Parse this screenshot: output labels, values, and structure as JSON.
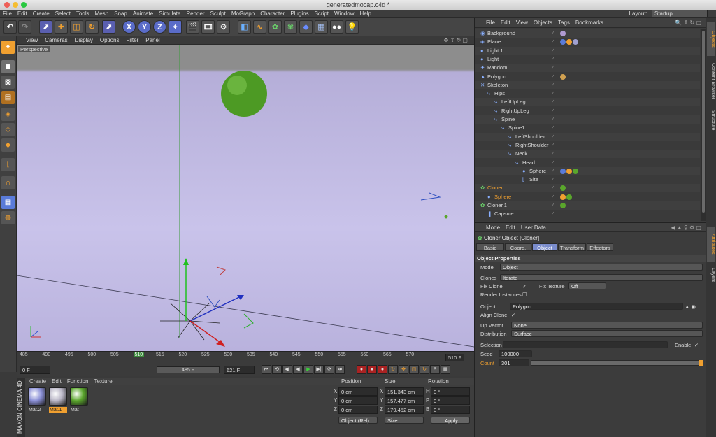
{
  "window": {
    "title": "generatedmocap.c4d *"
  },
  "menu": [
    "File",
    "Edit",
    "Create",
    "Select",
    "Tools",
    "Mesh",
    "Snap",
    "Animate",
    "Simulate",
    "Render",
    "Sculpt",
    "MoGraph",
    "Character",
    "Plugins",
    "Script",
    "Window",
    "Help"
  ],
  "layout": {
    "label": "Layout:",
    "value": "Startup"
  },
  "toolbar": {
    "x": "X",
    "y": "Y",
    "z": "Z"
  },
  "viewport": {
    "menu": [
      "View",
      "Cameras",
      "Display",
      "Options",
      "Filter",
      "Panel"
    ],
    "label": "Perspective"
  },
  "timeline": {
    "ticks": [
      "485",
      "490",
      "495",
      "500",
      "505",
      "510",
      "515",
      "520",
      "525",
      "530",
      "535",
      "540",
      "545",
      "550",
      "555",
      "560",
      "565",
      "570"
    ],
    "current": "510",
    "current_frame": "510 F"
  },
  "transport": {
    "start": "0 F",
    "mid": "485 F",
    "end": "621 F"
  },
  "materials": {
    "menu": [
      "Create",
      "Edit",
      "Function",
      "Texture"
    ],
    "items": [
      {
        "name": "Mat.2",
        "color": "#8a8fd6"
      },
      {
        "name": "Mat.1",
        "color": "#b9b6c6"
      },
      {
        "name": "Mat",
        "color": "#5aa62c"
      }
    ],
    "logo": "MAXON CINEMA 4D"
  },
  "coords": {
    "headers": [
      "Position",
      "Size",
      "Rotation"
    ],
    "rows": [
      {
        "axis": "X",
        "pos": "0 cm",
        "size": "151.343 cm",
        "rlabel": "H",
        "rot": "0 °"
      },
      {
        "axis": "Y",
        "pos": "0 cm",
        "size": "157.477 cm",
        "rlabel": "P",
        "rot": "0 °"
      },
      {
        "axis": "Z",
        "pos": "0 cm",
        "size": "179.452 cm",
        "rlabel": "B",
        "rot": "0 °"
      }
    ],
    "mode": "Object (Rel)",
    "size_mode": "Size",
    "apply": "Apply"
  },
  "objects": {
    "menu": [
      "File",
      "Edit",
      "View",
      "Objects",
      "Tags",
      "Bookmarks"
    ],
    "items": [
      {
        "name": "Background",
        "indent": 0,
        "tags": [
          "#b09ad0"
        ]
      },
      {
        "name": "Plane",
        "indent": 0,
        "tags": [
          "#5a7bd8",
          "#f0a030",
          "#a0a0d0"
        ]
      },
      {
        "name": "Light.1",
        "indent": 0,
        "tags": []
      },
      {
        "name": "Light",
        "indent": 0,
        "tags": []
      },
      {
        "name": "Random",
        "indent": 0,
        "tags": []
      },
      {
        "name": "Polygon",
        "indent": 0,
        "tags": [
          "#d0a050"
        ]
      },
      {
        "name": "Skeleton",
        "indent": 0,
        "tags": []
      },
      {
        "name": "Hips",
        "indent": 1,
        "tags": []
      },
      {
        "name": "LeftUpLeg",
        "indent": 2,
        "tags": []
      },
      {
        "name": "RightUpLeg",
        "indent": 2,
        "tags": []
      },
      {
        "name": "Spine",
        "indent": 2,
        "tags": []
      },
      {
        "name": "Spine1",
        "indent": 3,
        "tags": []
      },
      {
        "name": "LeftShoulder",
        "indent": 4,
        "tags": []
      },
      {
        "name": "RightShoulder",
        "indent": 4,
        "tags": []
      },
      {
        "name": "Neck",
        "indent": 4,
        "tags": []
      },
      {
        "name": "Head",
        "indent": 5,
        "tags": []
      },
      {
        "name": "Sphere",
        "indent": 6,
        "tags": [
          "#5a7bd8",
          "#f0a030",
          "#5aa62c"
        ]
      },
      {
        "name": "Site",
        "indent": 6,
        "tags": []
      },
      {
        "name": "Cloner",
        "indent": 0,
        "tags": [
          "#5aa62c"
        ],
        "highlight": true
      },
      {
        "name": "Sphere",
        "indent": 1,
        "tags": [
          "#f0a030",
          "#5aa62c"
        ],
        "highlight": true
      },
      {
        "name": "Cloner.1",
        "indent": 0,
        "tags": [
          "#5aa62c"
        ]
      },
      {
        "name": "Capsule",
        "indent": 1,
        "tags": []
      }
    ]
  },
  "attributes": {
    "menu": [
      "Mode",
      "Edit",
      "User Data"
    ],
    "title": "Cloner Object [Cloner]",
    "tabs": [
      "Basic",
      "Coord.",
      "Object",
      "Transform",
      "Effectors"
    ],
    "active_tab": "Object",
    "section": "Object Properties",
    "mode_label": "Mode",
    "mode_value": "Object",
    "clones_label": "Clones",
    "clones_value": "Iterate",
    "fix_clone": "Fix Clone",
    "fix_texture": "Fix Texture",
    "fix_texture_value": "Off",
    "render_instances": "Render Instances",
    "object_label": "Object",
    "object_value": "Polygon",
    "align_clone": "Align Clone",
    "up_vector_label": "Up Vector",
    "up_vector_value": "None",
    "distribution_label": "Distribution",
    "distribution_value": "Surface",
    "selection_label": "Selection",
    "enable_label": "Enable",
    "seed_label": "Seed",
    "seed_value": "100000",
    "count_label": "Count",
    "count_value": "301"
  },
  "side_tabs": {
    "right": [
      "Objects",
      "Content Browser",
      "Structure"
    ],
    "right2": [
      "Attributes",
      "Layers"
    ]
  },
  "colors": {
    "accent": "#f0a030",
    "green": "#5aa62c",
    "bg": "#3c3c3c"
  }
}
